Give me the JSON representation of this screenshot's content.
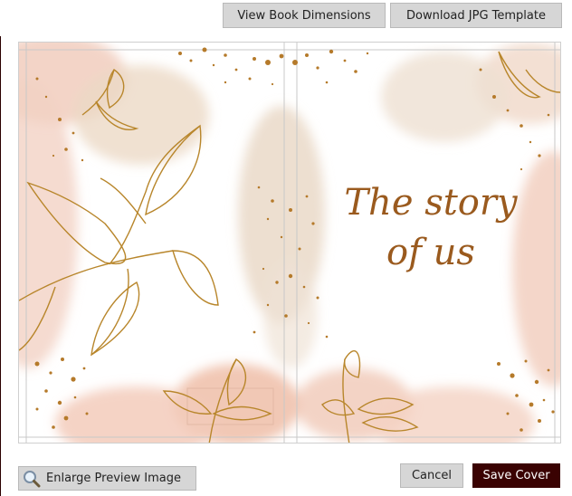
{
  "toolbar": {
    "view_dimensions_label": "View Book Dimensions",
    "download_template_label": "Download JPG Template"
  },
  "cover": {
    "title_line1": "The story",
    "title_line2": "of us"
  },
  "footer": {
    "enlarge_label": "Enlarge Preview Image",
    "enlarge_icon": "magnifier-icon",
    "cancel_label": "Cancel",
    "save_label": "Save Cover"
  },
  "colors": {
    "save_button_bg": "#3a0202",
    "button_bg": "#d6d6d6",
    "title_color": "#9a5a1e",
    "leaf_gold": "#b8862b",
    "watercolor_blush": "#f2c9b8",
    "watercolor_beige": "#eadccd"
  }
}
